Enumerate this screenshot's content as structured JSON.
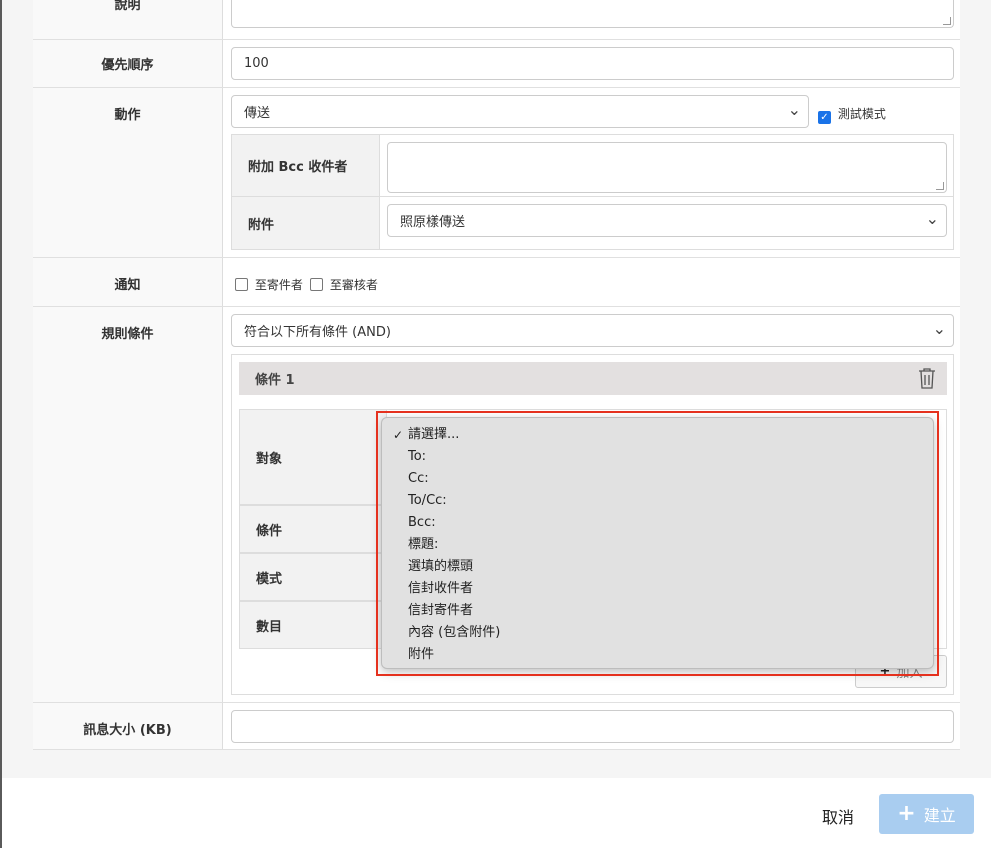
{
  "form": {
    "description_label": "說明",
    "priority_label": "優先順序",
    "priority_value": "100",
    "action_label": "動作",
    "action_value": "傳送",
    "test_mode_label": "測試模式",
    "test_mode_checked": true,
    "bcc_label": "附加 Bcc 收件者",
    "attachment_label": "附件",
    "attachment_value": "照原樣傳送",
    "notify_label": "通知",
    "notify_sender_label": "至寄件者",
    "notify_reviewer_label": "至審核者",
    "rule_condition_label": "規則條件",
    "rule_condition_value": "符合以下所有條件 (AND)",
    "condition_title": "條件 1",
    "target_label": "對象",
    "condition_label": "條件",
    "pattern_label": "模式",
    "count_label": "數目",
    "add_label": "加入",
    "message_size_label": "訊息大小 (KB)"
  },
  "dropdown": {
    "selected": "請選擇...",
    "options": [
      "請選擇...",
      "To:",
      "Cc:",
      "To/Cc:",
      "Bcc:",
      "標題:",
      "選填的標頭",
      "信封收件者",
      "信封寄件者",
      "內容 (包含附件)",
      "附件"
    ]
  },
  "footer": {
    "cancel_label": "取消",
    "create_label": "建立"
  },
  "colors": {
    "highlight": "#e5311e",
    "primary_disabled": "#a9cdf0",
    "checkbox": "#1a73e8"
  },
  "icons": {
    "trash": "trash-icon",
    "plus": "plus-icon",
    "check": "checkmark-icon",
    "chevron": "chevron-down-icon"
  }
}
